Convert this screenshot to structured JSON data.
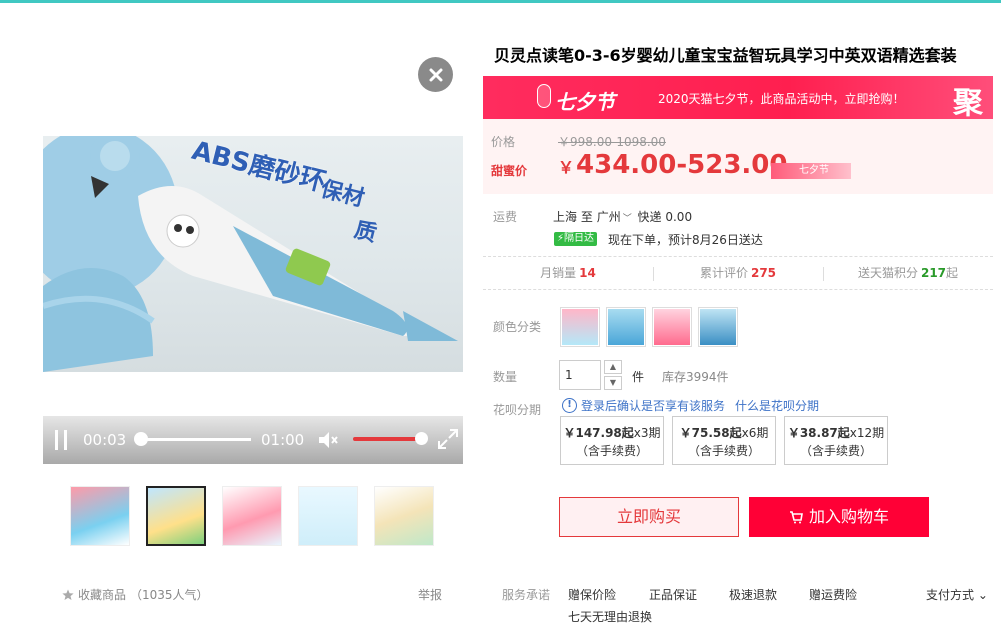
{
  "gallery": {
    "video": {
      "captions": [
        "ABS磨砂环",
        "保材",
        "质"
      ],
      "current_time": "00:03",
      "duration": "01:00",
      "progress": 0.05,
      "volume": 0.85
    },
    "thumbnails": [
      {
        "label": "",
        "active": false
      },
      {
        "label": "",
        "active": true
      },
      {
        "label": "",
        "active": false
      },
      {
        "label": "",
        "active": false
      },
      {
        "label": "",
        "active": false
      }
    ],
    "favorite": "收藏商品",
    "popularity": "（1035人气）",
    "report": "举报"
  },
  "product": {
    "title": "贝灵点读笔0-3-6岁婴幼儿童宝宝益智玩具学习中英双语精选套装",
    "promo": {
      "logo_text": "七夕节",
      "message": "2020天猫七夕节，此商品活动中，立即抢购！",
      "badge": "聚"
    },
    "price": {
      "label": "价格",
      "original": "￥998.00-1098.00",
      "sweet_label": "甜蜜价",
      "currency": "￥",
      "sweet": "434.00-523.00",
      "tag": "七夕节"
    },
    "shipping": {
      "label": "运费",
      "from": "上海",
      "to_word": "至",
      "to": "广州",
      "express": "快递 0.00",
      "badge": "隔日达",
      "eta": "现在下单，预计8月26日送达"
    },
    "stats": [
      {
        "label": "月销量",
        "value": "14",
        "suffix": ""
      },
      {
        "label": "累计评价",
        "value": "275",
        "suffix": ""
      },
      {
        "label": "送天猫积分",
        "value": "217",
        "suffix": "起"
      }
    ],
    "color": {
      "label": "颜色分类",
      "options": [
        "option-1",
        "option-2",
        "option-3",
        "option-4"
      ]
    },
    "quantity": {
      "label": "数量",
      "value": "1",
      "unit": "件",
      "stock": "库存3994件"
    },
    "huabei": {
      "label": "花呗分期",
      "info": "登录后确认是否享有该服务",
      "what": "什么是花呗分期",
      "plans": [
        {
          "amount": "￥147.98起",
          "term": "x3期",
          "fee": "（含手续费）"
        },
        {
          "amount": "￥75.58起",
          "term": "x6期",
          "fee": "（含手续费）"
        },
        {
          "amount": "￥38.87起",
          "term": "x12期",
          "fee": "（含手续费）"
        }
      ]
    },
    "buttons": {
      "buy_now": "立即购买",
      "add_cart": "加入购物车"
    },
    "service": {
      "label": "服务承诺",
      "items": [
        "赠保价险",
        "正品保证",
        "极速退款",
        "赠运费险",
        "七天无理由退换"
      ],
      "payment": "支付方式"
    }
  },
  "colors": {
    "accent": "#e4393c",
    "tmall_red": "#ff0036",
    "top_bar": "#40c8c2"
  }
}
